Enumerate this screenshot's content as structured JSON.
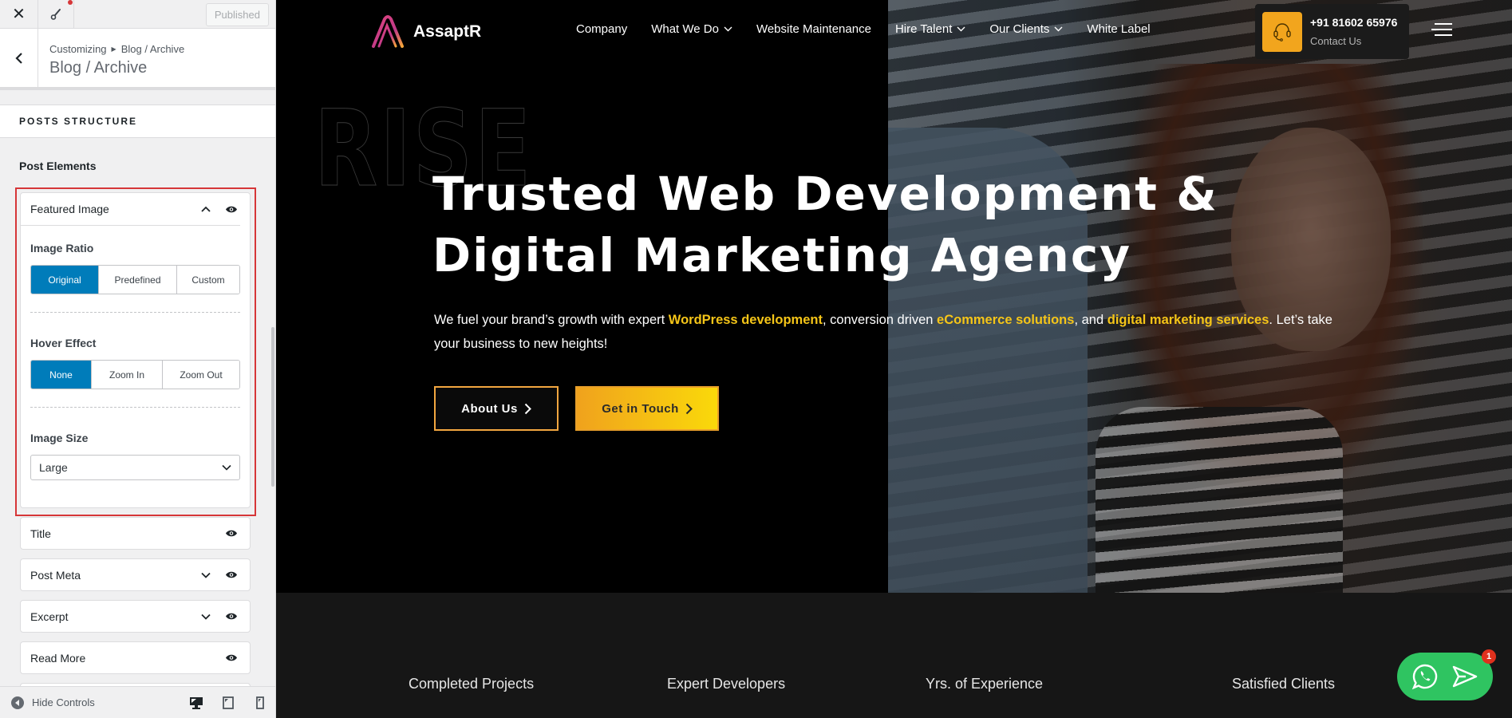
{
  "sidebar": {
    "published_label": "Published",
    "breadcrumb": {
      "root": "Customizing",
      "current": "Blog / Archive"
    },
    "title": "Blog / Archive",
    "section_title": "POSTS STRUCTURE",
    "post_elements_label": "Post Elements",
    "featured_image": {
      "name": "Featured Image",
      "image_ratio": {
        "label": "Image Ratio",
        "options": [
          "Original",
          "Predefined",
          "Custom"
        ],
        "selected": "Original"
      },
      "hover_effect": {
        "label": "Hover Effect",
        "options": [
          "None",
          "Zoom In",
          "Zoom Out"
        ],
        "selected": "None"
      },
      "image_size": {
        "label": "Image Size",
        "value": "Large"
      }
    },
    "elements": [
      {
        "name": "Title",
        "expandable": false
      },
      {
        "name": "Post Meta",
        "expandable": true
      },
      {
        "name": "Excerpt",
        "expandable": true
      },
      {
        "name": "Read More",
        "expandable": false
      }
    ],
    "footer": {
      "hide_controls_label": "Hide Controls"
    }
  },
  "site": {
    "logo_text": "AssaptR",
    "nav": [
      {
        "label": "Company",
        "dropdown": false
      },
      {
        "label": "What We Do",
        "dropdown": true
      },
      {
        "label": "Website Maintenance",
        "dropdown": false
      },
      {
        "label": "Hire Talent",
        "dropdown": true
      },
      {
        "label": "Our Clients",
        "dropdown": true
      },
      {
        "label": "White Label",
        "dropdown": false
      }
    ],
    "contact": {
      "phone": "+91 81602 65976",
      "label": "Contact Us"
    },
    "hero": {
      "watermark": "RISE",
      "headline_line1": "Trusted Web Development &",
      "headline_line2": "Digital Marketing Agency",
      "lead": {
        "p1": "We fuel your brand’s growth with expert ",
        "h1": "WordPress development",
        "p2": ", conversion driven ",
        "h2": "eCommerce solutions",
        "p3": ", and ",
        "h3": "digital marketing services",
        "p4": ". Let’s take your business to new heights!"
      },
      "about_label": "About Us",
      "touch_label": "Get in Touch"
    },
    "stats": [
      "Completed Projects",
      "Expert Developers",
      "Yrs. of Experience",
      "Satisfied Clients"
    ],
    "chat_badge": "1"
  },
  "colors": {
    "accent_blue": "#007cba",
    "highlight_yellow": "#f5c518",
    "brand_orange": "#f2a51d",
    "whatsapp_green": "#2fc461",
    "frame_red": "#d63638"
  }
}
